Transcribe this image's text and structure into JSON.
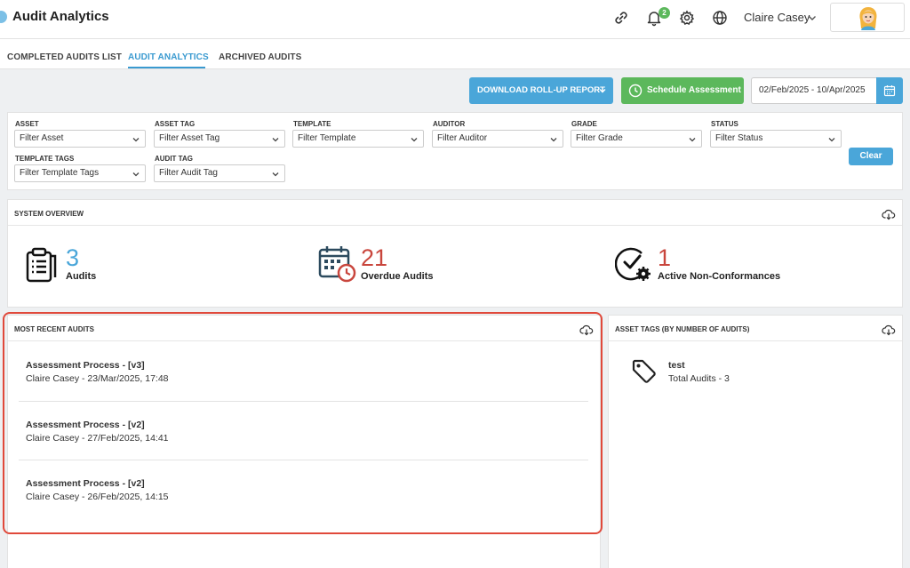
{
  "header": {
    "title": "Audit Analytics",
    "notification_count": "2",
    "user_name": "Claire Casey",
    "icons": [
      "link-icon",
      "bell-icon",
      "gear-icon",
      "globe-icon",
      "chevron-down-icon",
      "avatar"
    ]
  },
  "tabs": [
    {
      "label": "COMPLETED AUDITS LIST",
      "active": false
    },
    {
      "label": "AUDIT ANALYTICS",
      "active": true
    },
    {
      "label": "ARCHIVED AUDITS",
      "active": false
    }
  ],
  "toolbar": {
    "download_label": "DOWNLOAD ROLL-UP REPORT",
    "schedule_label": "Schedule Assessment",
    "date_range": "02/Feb/2025 - 10/Apr/2025"
  },
  "filters": {
    "items": [
      {
        "label": "ASSET",
        "placeholder": "Filter Asset"
      },
      {
        "label": "ASSET TAG",
        "placeholder": "Filter Asset Tag"
      },
      {
        "label": "TEMPLATE",
        "placeholder": "Filter Template"
      },
      {
        "label": "AUDITOR",
        "placeholder": "Filter Auditor"
      },
      {
        "label": "GRADE",
        "placeholder": "Filter Grade"
      },
      {
        "label": "STATUS",
        "placeholder": "Filter Status"
      },
      {
        "label": "TEMPLATE TAGS",
        "placeholder": "Filter Template Tags"
      },
      {
        "label": "AUDIT TAG",
        "placeholder": "Filter Audit Tag"
      }
    ],
    "clear_label": "Clear"
  },
  "overview": {
    "title": "SYSTEM OVERVIEW",
    "stats": [
      {
        "value": "3",
        "label": "Audits",
        "color": "#4aa6d9"
      },
      {
        "value": "21",
        "label": "Overdue Audits",
        "color": "#c9463d"
      },
      {
        "value": "1",
        "label": "Active Non-Conformances",
        "color": "#c9463d"
      }
    ]
  },
  "recent": {
    "title": "MOST RECENT AUDITS",
    "items": [
      {
        "name": "Assessment Process - [v3]",
        "meta": "Claire Casey - 23/Mar/2025, 17:48"
      },
      {
        "name": "Assessment Process - [v2]",
        "meta": "Claire Casey - 27/Feb/2025, 14:41"
      },
      {
        "name": "Assessment Process - [v2]",
        "meta": "Claire Casey - 26/Feb/2025, 14:15"
      }
    ]
  },
  "asset_tags": {
    "title": "ASSET TAGS (BY NUMBER OF AUDITS)",
    "items": [
      {
        "name": "test",
        "count": "Total Audits - 3"
      }
    ]
  },
  "colors": {
    "accent": "#4aa6d9",
    "success": "#5cb85c",
    "danger": "#c9463d",
    "highlight": "#e0493b"
  }
}
